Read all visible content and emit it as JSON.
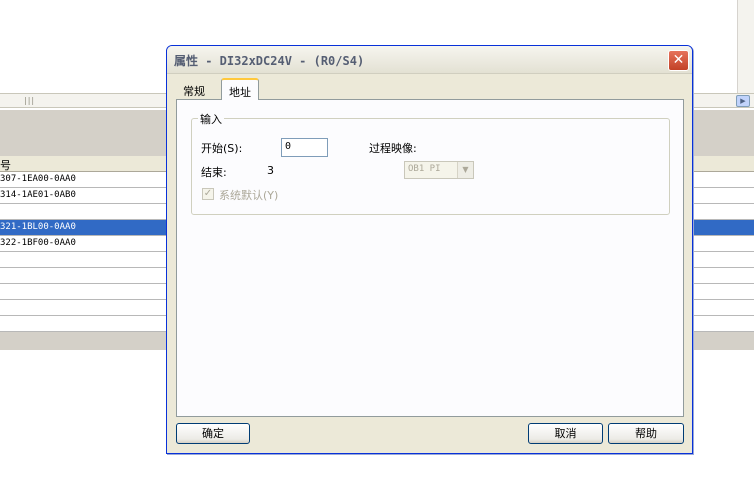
{
  "background": {
    "header_fragment": "号",
    "rows": [
      {
        "text": "307-1EA00-0AA0",
        "selected": false
      },
      {
        "text": "314-1AE01-0AB0",
        "selected": false
      },
      {
        "text": "",
        "selected": false
      },
      {
        "text": "321-1BL00-0AA0",
        "selected": true
      },
      {
        "text": "322-1BF00-0AA0",
        "selected": false
      },
      {
        "text": "",
        "selected": false
      },
      {
        "text": "",
        "selected": false
      },
      {
        "text": "",
        "selected": false
      },
      {
        "text": "",
        "selected": false
      },
      {
        "text": "",
        "selected": false
      }
    ]
  },
  "dialog": {
    "title": "属性 - DI32xDC24V - (R0/S4)",
    "close_glyph": "✕",
    "tabs": [
      {
        "label": "常规",
        "active": false
      },
      {
        "label": "地址",
        "active": true
      }
    ],
    "group_label": "输入",
    "start_label": "开始(S):",
    "start_value": "0",
    "end_label": "结束:",
    "end_value": "3",
    "process_image_label": "过程映像:",
    "process_image_value": "OB1 PI",
    "system_default_label": "系统默认(Y)",
    "system_default_checked": true,
    "buttons": {
      "ok": "确定",
      "cancel": "取消",
      "help": "帮助"
    }
  }
}
